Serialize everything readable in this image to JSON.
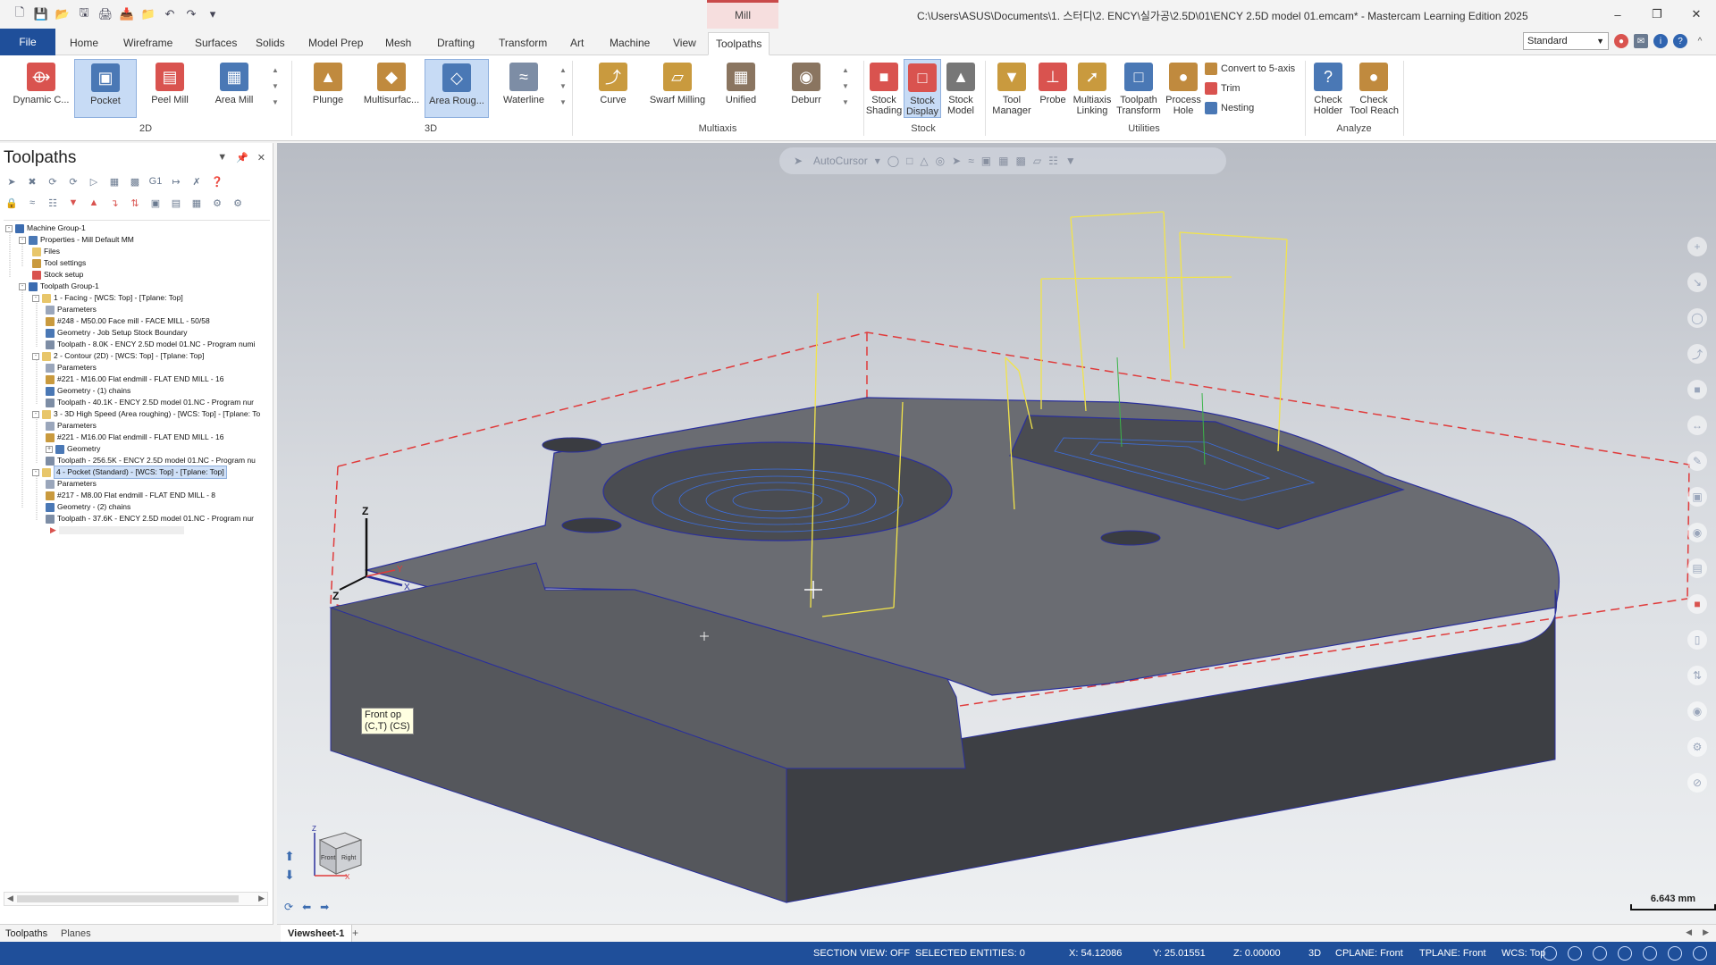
{
  "app": {
    "window_title": "C:\\Users\\ASUS\\Documents\\1. 스터디\\2. ENCY\\실가공\\2.5D\\01\\ENCY 2.5D model 01.emcam* - Mastercam Learning Edition 2025",
    "context_tab": "Mill"
  },
  "ribbon_tabs": [
    "File",
    "Home",
    "Wireframe",
    "Surfaces",
    "Solids",
    "Model Prep",
    "Mesh",
    "Drafting",
    "Transform",
    "Art",
    "Machine",
    "View",
    "Toolpaths"
  ],
  "ribbon_active_tab": "Toolpaths",
  "standard_select": "Standard",
  "ribbon": {
    "groups": {
      "g2d": "2D",
      "g3d": "3D",
      "multiaxis": "Multiaxis",
      "stock": "Stock",
      "utilities": "Utilities",
      "analyze": "Analyze"
    },
    "buttons_2d": [
      {
        "label": "Dynamic C...",
        "icon": "dynamic-contour-icon",
        "color": "#d9534f"
      },
      {
        "label": "Pocket",
        "icon": "pocket-icon",
        "color": "#4a78b5"
      },
      {
        "label": "Peel Mill",
        "icon": "peel-mill-icon",
        "color": "#d9534f"
      },
      {
        "label": "Area Mill",
        "icon": "area-mill-icon",
        "color": "#4a78b5"
      }
    ],
    "buttons_3d": [
      {
        "label": "Plunge",
        "icon": "plunge-icon",
        "color": "#c08a3e"
      },
      {
        "label": "Multisurfac...",
        "icon": "multisurface-icon",
        "color": "#c08a3e"
      },
      {
        "label": "Area Roug...",
        "icon": "area-roughing-icon",
        "color": "#4a78b5"
      },
      {
        "label": "Waterline",
        "icon": "waterline-icon",
        "color": "#7d8da5"
      }
    ],
    "buttons_multiaxis": [
      {
        "label": "Curve",
        "icon": "curve-icon",
        "color": "#c99a3e"
      },
      {
        "label": "Swarf Milling",
        "icon": "swarf-milling-icon",
        "color": "#c99a3e"
      },
      {
        "label": "Unified",
        "icon": "unified-icon",
        "color": "#8a7560"
      },
      {
        "label": "Deburr",
        "icon": "deburr-icon",
        "color": "#8a7560"
      }
    ],
    "buttons_stock": [
      {
        "label": "Stock\nShading",
        "icon": "stock-shading-icon",
        "color": "#d9534f"
      },
      {
        "label": "Stock\nDisplay",
        "icon": "stock-display-icon",
        "color": "#d9534f"
      },
      {
        "label": "Stock\nModel",
        "icon": "stock-model-icon",
        "color": "#777"
      }
    ],
    "buttons_utilities": [
      {
        "label": "Tool\nManager",
        "icon": "tool-manager-icon",
        "color": "#c99a3e"
      },
      {
        "label": "Probe",
        "icon": "probe-icon",
        "color": "#d9534f"
      },
      {
        "label": "Multiaxis\nLinking",
        "icon": "multiaxis-linking-icon",
        "color": "#c99a3e"
      },
      {
        "label": "Toolpath\nTransform",
        "icon": "toolpath-transform-icon",
        "color": "#4a78b5"
      },
      {
        "label": "Process\nHole",
        "icon": "process-hole-icon",
        "color": "#c08a3e"
      }
    ],
    "small_utilities": [
      {
        "label": "Convert to 5-axis",
        "icon": "convert-5axis-icon"
      },
      {
        "label": "Trim",
        "icon": "trim-icon"
      },
      {
        "label": "Nesting",
        "icon": "nesting-icon"
      }
    ],
    "buttons_analyze": [
      {
        "label": "Check\nHolder",
        "icon": "check-holder-icon",
        "color": "#4a78b5"
      },
      {
        "label": "Check\nTool Reach",
        "icon": "check-tool-reach-icon",
        "color": "#c08a3e"
      }
    ]
  },
  "panel": {
    "title": "Toolpaths",
    "tabs": [
      "Toolpaths",
      "Planes"
    ],
    "tree": [
      {
        "text": "Machine Group-1",
        "level": 0,
        "icon": "machine-group-icon",
        "exp": "-"
      },
      {
        "text": "Properties - Mill Default MM",
        "level": 1,
        "icon": "properties-icon",
        "exp": "-"
      },
      {
        "text": "Files",
        "level": 2,
        "icon": "folder-icon"
      },
      {
        "text": "Tool settings",
        "level": 2,
        "icon": "tool-settings-icon"
      },
      {
        "text": "Stock setup",
        "level": 2,
        "icon": "stock-setup-icon"
      },
      {
        "text": "Toolpath Group-1",
        "level": 1,
        "icon": "toolpath-group-icon",
        "exp": "-"
      },
      {
        "text": "1 - Facing - [WCS: Top] - [Tplane: Top]",
        "level": 2,
        "icon": "folder-icon",
        "exp": "-"
      },
      {
        "text": "Parameters",
        "level": 3,
        "icon": "parameters-icon"
      },
      {
        "text": "#248 - M50.00 Face mill - FACE MILL - 50/58",
        "level": 3,
        "icon": "tool-icon"
      },
      {
        "text": "Geometry - Job Setup Stock Boundary",
        "level": 3,
        "icon": "geometry-icon"
      },
      {
        "text": "Toolpath - 8.0K - ENCY 2.5D model 01.NC - Program numi",
        "level": 3,
        "icon": "toolpath-icon"
      },
      {
        "text": "2 - Contour (2D) - [WCS: Top] - [Tplane: Top]",
        "level": 2,
        "icon": "folder-icon",
        "exp": "-"
      },
      {
        "text": "Parameters",
        "level": 3,
        "icon": "parameters-icon"
      },
      {
        "text": "#221 - M16.00 Flat endmill - FLAT END MILL - 16",
        "level": 3,
        "icon": "tool-icon"
      },
      {
        "text": "Geometry - (1) chains",
        "level": 3,
        "icon": "geometry-icon"
      },
      {
        "text": "Toolpath - 40.1K - ENCY 2.5D model 01.NC - Program nur",
        "level": 3,
        "icon": "toolpath-icon"
      },
      {
        "text": "3 - 3D High Speed (Area roughing) - [WCS: Top] - [Tplane: To",
        "level": 2,
        "icon": "folder-icon",
        "exp": "-"
      },
      {
        "text": "Parameters",
        "level": 3,
        "icon": "parameters-icon"
      },
      {
        "text": "#221 - M16.00 Flat endmill - FLAT END MILL - 16",
        "level": 3,
        "icon": "tool-icon"
      },
      {
        "text": "Geometry",
        "level": 3,
        "icon": "geometry-icon",
        "exp": "+"
      },
      {
        "text": "Toolpath - 256.5K - ENCY 2.5D model 01.NC - Program nu",
        "level": 3,
        "icon": "toolpath-icon"
      },
      {
        "text": "4 - Pocket (Standard) - [WCS: Top] - [Tplane: Top]",
        "level": 2,
        "icon": "folder-icon",
        "exp": "-",
        "highlight": true
      },
      {
        "text": "Parameters",
        "level": 3,
        "icon": "parameters-icon"
      },
      {
        "text": "#217 - M8.00 Flat endmill - FLAT END MILL - 8",
        "level": 3,
        "icon": "tool-icon"
      },
      {
        "text": "Geometry - (2) chains",
        "level": 3,
        "icon": "geometry-icon"
      },
      {
        "text": "Toolpath - 37.6K - ENCY 2.5D model 01.NC - Program nur",
        "level": 3,
        "icon": "toolpath-icon"
      }
    ]
  },
  "viewport": {
    "autocursor_label": "AutoCursor",
    "tooltip": "Front op\n(C,T) (CS)",
    "scale": "6.643 mm",
    "axis_labels": {
      "z": "Z",
      "x": "X",
      "y": "Y",
      "z2": "Z"
    },
    "cube_labels": {
      "front": "Front",
      "right": "Right",
      "z": "Z",
      "x": "X"
    }
  },
  "sheets": {
    "tab": "Viewsheet-1",
    "add": "+"
  },
  "status": {
    "section_view": "SECTION VIEW: OFF",
    "selected": "SELECTED ENTITIES: 0",
    "x": "X:  54.12086",
    "y": "Y:  25.01551",
    "z": "Z:  0.00000",
    "mode": "3D",
    "cplane": "CPLANE: Front",
    "tplane": "TPLANE: Front",
    "wcs": "WCS: Top"
  },
  "colors": {
    "accent": "#1f4f9a",
    "selected_btn": "#c7dbf5",
    "part": "#55575c",
    "edges": "#2a2f9c",
    "toolpath_yellow": "#f2e44a",
    "stock_red": "#e03a3a"
  }
}
